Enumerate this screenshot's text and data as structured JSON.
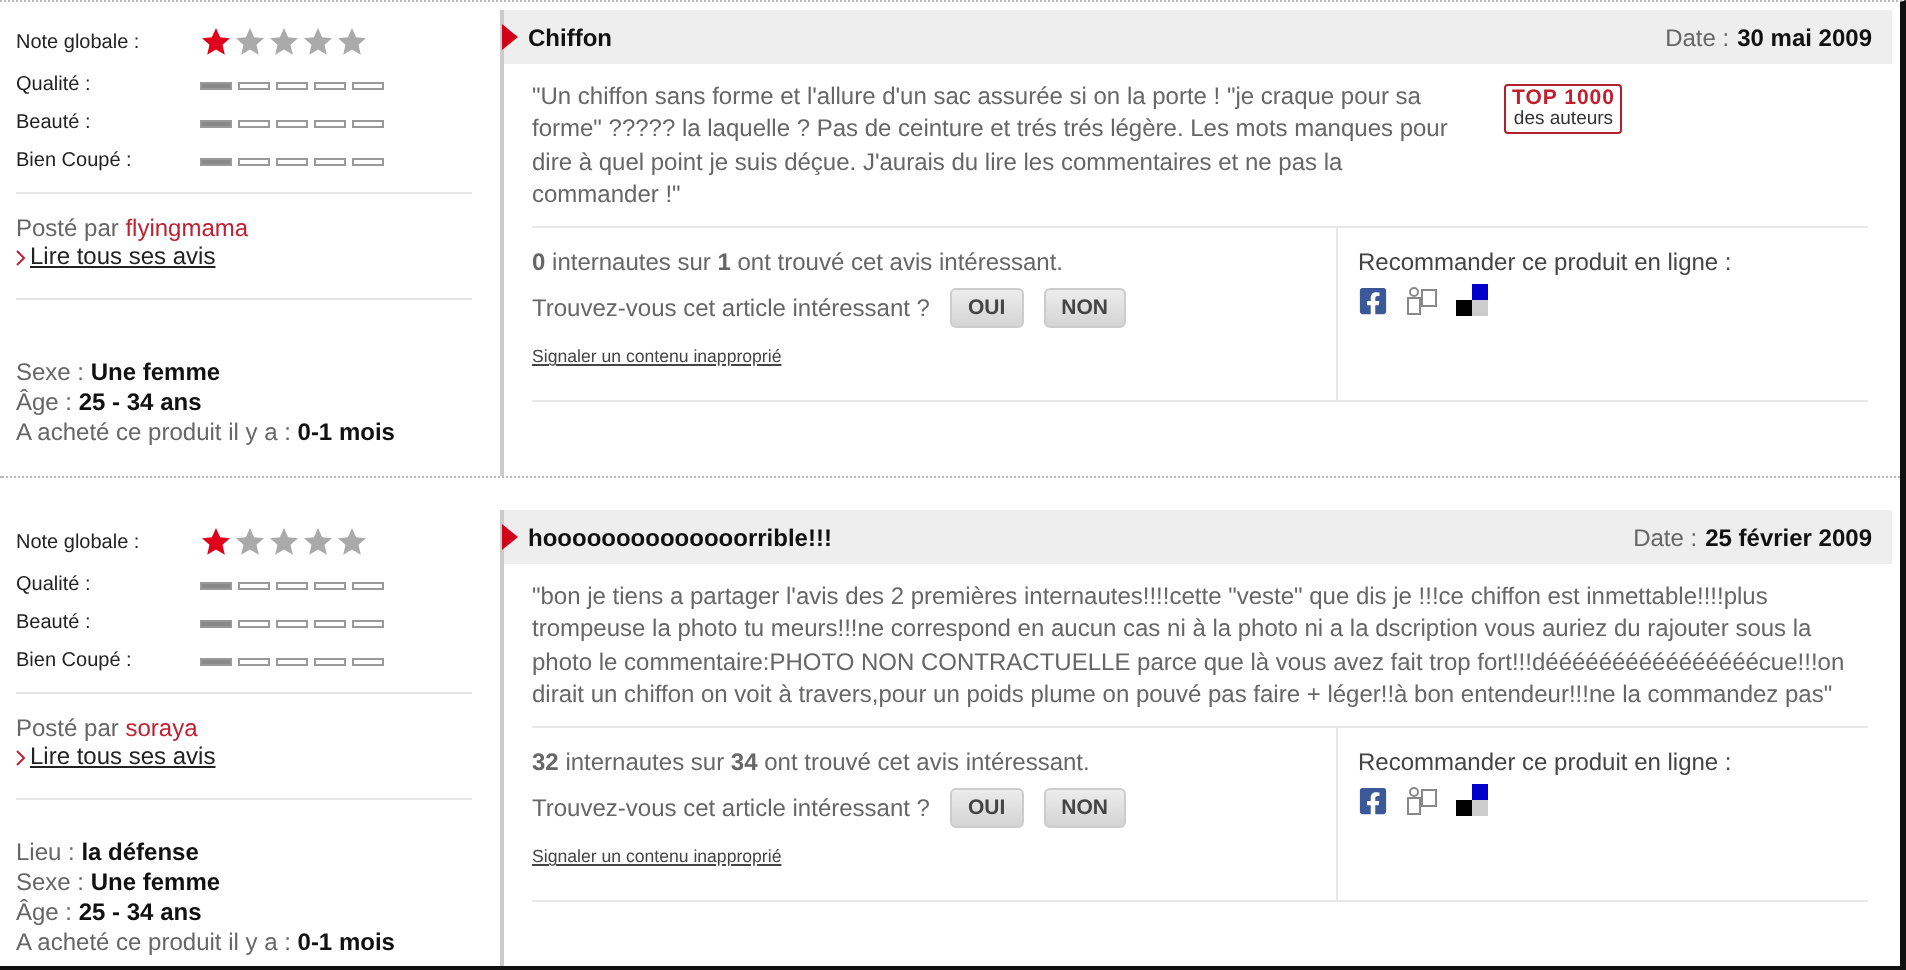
{
  "reviews": [
    {
      "stars": 1,
      "rating_label": "Note globale :",
      "criteria": [
        {
          "label": "Qualité :",
          "level": 0.2
        },
        {
          "label": "Beauté :",
          "level": 0.2
        },
        {
          "label": "Bien Coupé :",
          "level": 0.2
        }
      ],
      "posted_label": "Posté par",
      "author": "flyingmama",
      "read_all": "Lire tous ses avis",
      "details": [
        {
          "label": "Sexe :",
          "value": "Une femme"
        },
        {
          "label": "Âge :",
          "value": "25 - 34 ans"
        },
        {
          "label": "A acheté ce produit il y a :",
          "value": "0-1 mois"
        }
      ],
      "title": "Chiffon",
      "date_label": "Date :",
      "date": "30 mai 2009",
      "text": "\"Un chiffon sans forme et l'allure d'un sac assurée si on la porte ! \"je craque pour sa forme\" ????? la laquelle ? Pas de ceinture et trés trés légère. Les mots manques pour dire à quel point je suis déçue. J'aurais du lire les commentaires et ne pas la commander !\"",
      "badge": {
        "top": "TOP 1000",
        "bottom": "des auteurs"
      },
      "helpful": "**0** internautes sur **1** ont trouvé cet avis intéressant.",
      "question": "Trouvez-vous cet article intéressant ?",
      "buttons": [
        "OUI",
        "NON"
      ],
      "report": "Signaler un contenu inapproprié",
      "recommend": "Recommander ce produit en ligne :"
    },
    {
      "stars": 1,
      "rating_label": "Note globale :",
      "criteria": [
        {
          "label": "Qualité :",
          "level": 0.2
        },
        {
          "label": "Beauté :",
          "level": 0.2
        },
        {
          "label": "Bien Coupé :",
          "level": 0.2
        }
      ],
      "posted_label": "Posté par",
      "author": "soraya",
      "read_all": "Lire tous ses avis",
      "details": [
        {
          "label": "Lieu :",
          "value": "la défense"
        },
        {
          "label": "Sexe :",
          "value": "Une femme"
        },
        {
          "label": "Âge :",
          "value": "25 - 34 ans"
        },
        {
          "label": "A acheté ce produit il y a :",
          "value": "0-1 mois"
        }
      ],
      "title": "hoooooooooooooorrible!!!",
      "date_label": "Date :",
      "date": "25 février 2009",
      "text": "\"bon je tiens a partager l'avis des 2 premières internautes!!!!cette \"veste\" que dis je !!!ce chiffon est inmettable!!!!plus trompeuse la photo tu meurs!!!ne correspond en aucun cas ni à la photo ni a la dscription vous auriez du rajouter sous la photo le commentaire:PHOTO NON CONTRACTUELLE parce que là vous avez fait trop fort!!!déééééééééééééééécue!!!on dirait un chiffon on voit à travers,pour un poids plume on pouvé pas faire + léger!!à bon entendeur!!!ne la commandez pas\"",
      "helpful": "**32** internautes sur **34** ont trouvé cet avis intéressant.",
      "question": "Trouvez-vous cet article intéressant ?",
      "buttons": [
        "OUI",
        "NON"
      ],
      "report": "Signaler un contenu inapproprié",
      "recommend": "Recommander ce produit en ligne :"
    }
  ]
}
